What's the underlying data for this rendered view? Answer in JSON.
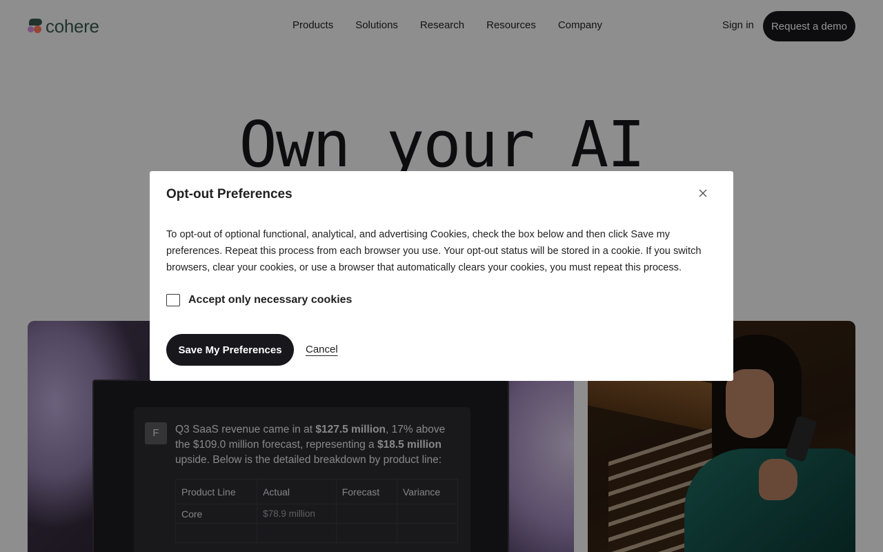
{
  "brand": {
    "name": "cohere"
  },
  "nav": {
    "links": [
      "Products",
      "Solutions",
      "Research",
      "Resources",
      "Company"
    ],
    "sign_in": "Sign in",
    "cta": "Request a demo"
  },
  "hero": {
    "title": "Own your AI"
  },
  "showcase": {
    "avatar_initial": "F",
    "message_parts": [
      "Q3 SaaS revenue came in at ",
      "$127.5 million",
      ", 17% above the $109.0 million forecast, representing a ",
      "$18.5 million",
      " upside. Below is the detailed breakdown by product line:"
    ],
    "table": {
      "headers": [
        "Product Line",
        "Actual",
        "Forecast",
        "Variance"
      ],
      "rows": [
        [
          "Core",
          "$78.9 million",
          "",
          ""
        ],
        [
          "",
          "",
          "",
          ""
        ]
      ]
    }
  },
  "modal": {
    "title": "Opt-out Preferences",
    "description": "To opt-out of optional functional, analytical, and advertising Cookies, check the box below and then click Save my preferences. Repeat this process from each browser you use. Your opt-out status will be stored in a cookie. If you switch browsers, clear your cookies, or use a browser that automatically clears your cookies, you must repeat this process.",
    "checkbox_label": "Accept only necessary cookies",
    "checkbox_checked": false,
    "save_label": "Save My Preferences",
    "cancel_label": "Cancel"
  },
  "colors": {
    "brand_green": "#39594d",
    "dark": "#17171c",
    "overlay": "rgba(0,0,0,0.42)"
  }
}
